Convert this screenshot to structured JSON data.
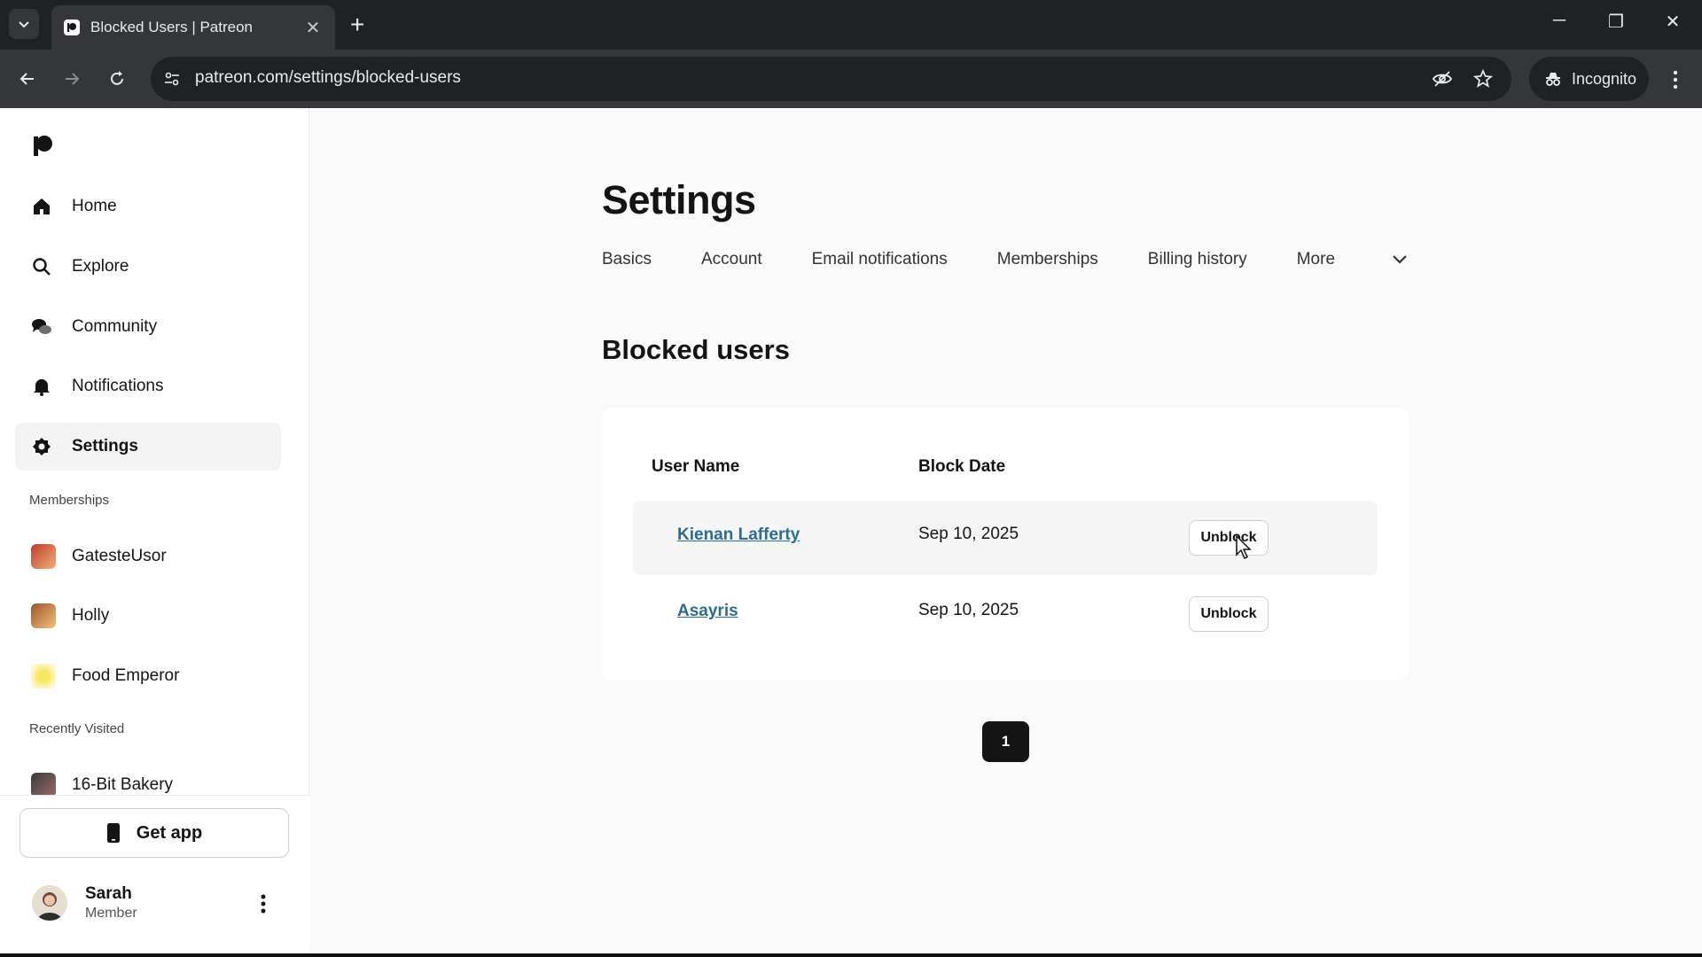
{
  "browser": {
    "tab_title": "Blocked Users | Patreon",
    "url": "patreon.com/settings/blocked-users",
    "incognito_label": "Incognito"
  },
  "sidebar": {
    "nav": [
      {
        "label": "Home",
        "icon": "home-icon"
      },
      {
        "label": "Explore",
        "icon": "search-icon"
      },
      {
        "label": "Community",
        "icon": "chat-icon"
      },
      {
        "label": "Notifications",
        "icon": "bell-icon"
      },
      {
        "label": "Settings",
        "icon": "gear-icon",
        "active": true
      }
    ],
    "memberships_label": "Memberships",
    "memberships": [
      {
        "label": "GatesteUsor"
      },
      {
        "label": "Holly"
      },
      {
        "label": "Food Emperor"
      }
    ],
    "recent_label": "Recently Visited",
    "recent": [
      {
        "label": "16-Bit Bakery"
      }
    ],
    "get_app_label": "Get app",
    "user": {
      "name": "Sarah",
      "role": "Member"
    }
  },
  "main": {
    "title": "Settings",
    "tabs": [
      "Basics",
      "Account",
      "Email notifications",
      "Memberships",
      "Billing history",
      "More"
    ],
    "section_title": "Blocked users",
    "table": {
      "headers": [
        "User Name",
        "Block Date"
      ],
      "rows": [
        {
          "user": "Kienan Lafferty",
          "date": "Sep 10, 2025",
          "action": "Unblock"
        },
        {
          "user": "Asayris",
          "date": "Sep 10, 2025",
          "action": "Unblock"
        }
      ]
    },
    "pagination": {
      "current": "1"
    }
  },
  "colors": {
    "link": "#2e6b8f",
    "accent_dark": "#141414",
    "chrome_bg": "#202124"
  }
}
